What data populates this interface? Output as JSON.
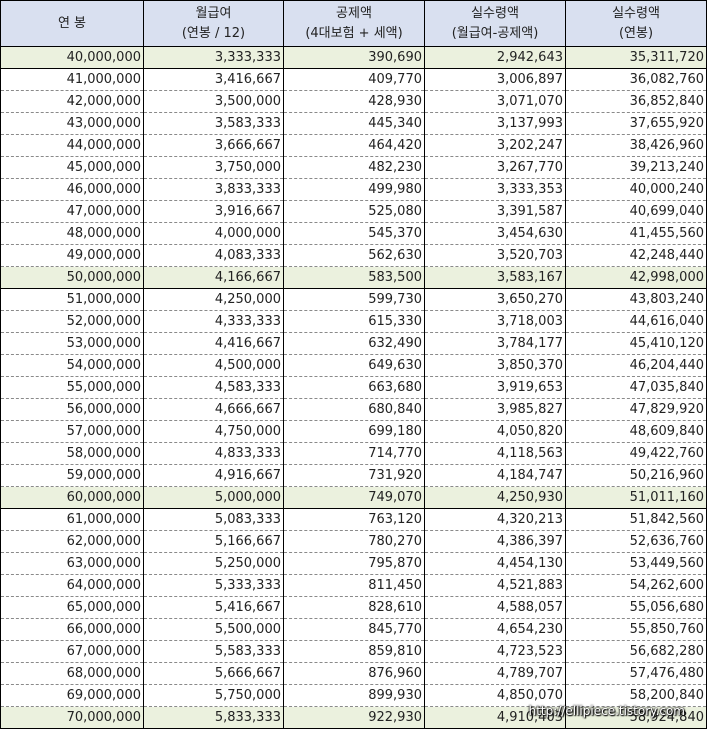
{
  "header": {
    "col0": {
      "line1": "연 봉"
    },
    "col1": {
      "line1": "월급여",
      "line2": "(연봉 / 12)"
    },
    "col2": {
      "line1": "공제액",
      "line2": "(4대보험 + 세액)"
    },
    "col3": {
      "line1": "실수령액",
      "line2": "(월급여-공제액)"
    },
    "col4": {
      "line1": "실수령액",
      "line2": "(연봉)"
    }
  },
  "rows": [
    [
      "40,000,000",
      "3,333,333",
      "390,690",
      "2,942,643",
      "35,311,720"
    ],
    [
      "41,000,000",
      "3,416,667",
      "409,770",
      "3,006,897",
      "36,082,760"
    ],
    [
      "42,000,000",
      "3,500,000",
      "428,930",
      "3,071,070",
      "36,852,840"
    ],
    [
      "43,000,000",
      "3,583,333",
      "445,340",
      "3,137,993",
      "37,655,920"
    ],
    [
      "44,000,000",
      "3,666,667",
      "464,420",
      "3,202,247",
      "38,426,960"
    ],
    [
      "45,000,000",
      "3,750,000",
      "482,230",
      "3,267,770",
      "39,213,240"
    ],
    [
      "46,000,000",
      "3,833,333",
      "499,980",
      "3,333,353",
      "40,000,240"
    ],
    [
      "47,000,000",
      "3,916,667",
      "525,080",
      "3,391,587",
      "40,699,040"
    ],
    [
      "48,000,000",
      "4,000,000",
      "545,370",
      "3,454,630",
      "41,455,560"
    ],
    [
      "49,000,000",
      "4,083,333",
      "562,630",
      "3,520,703",
      "42,248,440"
    ],
    [
      "50,000,000",
      "4,166,667",
      "583,500",
      "3,583,167",
      "42,998,000"
    ],
    [
      "51,000,000",
      "4,250,000",
      "599,730",
      "3,650,270",
      "43,803,240"
    ],
    [
      "52,000,000",
      "4,333,333",
      "615,330",
      "3,718,003",
      "44,616,040"
    ],
    [
      "53,000,000",
      "4,416,667",
      "632,490",
      "3,784,177",
      "45,410,120"
    ],
    [
      "54,000,000",
      "4,500,000",
      "649,630",
      "3,850,370",
      "46,204,440"
    ],
    [
      "55,000,000",
      "4,583,333",
      "663,680",
      "3,919,653",
      "47,035,840"
    ],
    [
      "56,000,000",
      "4,666,667",
      "680,840",
      "3,985,827",
      "47,829,920"
    ],
    [
      "57,000,000",
      "4,750,000",
      "699,180",
      "4,050,820",
      "48,609,840"
    ],
    [
      "58,000,000",
      "4,833,333",
      "714,770",
      "4,118,563",
      "49,422,760"
    ],
    [
      "59,000,000",
      "4,916,667",
      "731,920",
      "4,184,747",
      "50,216,960"
    ],
    [
      "60,000,000",
      "5,000,000",
      "749,070",
      "4,250,930",
      "51,011,160"
    ],
    [
      "61,000,000",
      "5,083,333",
      "763,120",
      "4,320,213",
      "51,842,560"
    ],
    [
      "62,000,000",
      "5,166,667",
      "780,270",
      "4,386,397",
      "52,636,760"
    ],
    [
      "63,000,000",
      "5,250,000",
      "795,870",
      "4,454,130",
      "53,449,560"
    ],
    [
      "64,000,000",
      "5,333,333",
      "811,450",
      "4,521,883",
      "54,262,600"
    ],
    [
      "65,000,000",
      "5,416,667",
      "828,610",
      "4,588,057",
      "55,056,680"
    ],
    [
      "66,000,000",
      "5,500,000",
      "845,770",
      "4,654,230",
      "55,850,760"
    ],
    [
      "67,000,000",
      "5,583,333",
      "859,810",
      "4,723,523",
      "56,682,280"
    ],
    [
      "68,000,000",
      "5,666,667",
      "876,960",
      "4,789,707",
      "57,476,480"
    ],
    [
      "69,000,000",
      "5,750,000",
      "899,930",
      "4,850,070",
      "58,200,840"
    ],
    [
      "70,000,000",
      "5,833,333",
      "922,930",
      "4,910,403",
      "58,924,840"
    ]
  ],
  "highlight_rows": [
    0,
    10,
    20,
    30
  ],
  "watermark": "http://ellipiece.tistory.com",
  "colors": {
    "header_bg": "#d9e0f0",
    "highlight_bg": "#ebf1de"
  }
}
